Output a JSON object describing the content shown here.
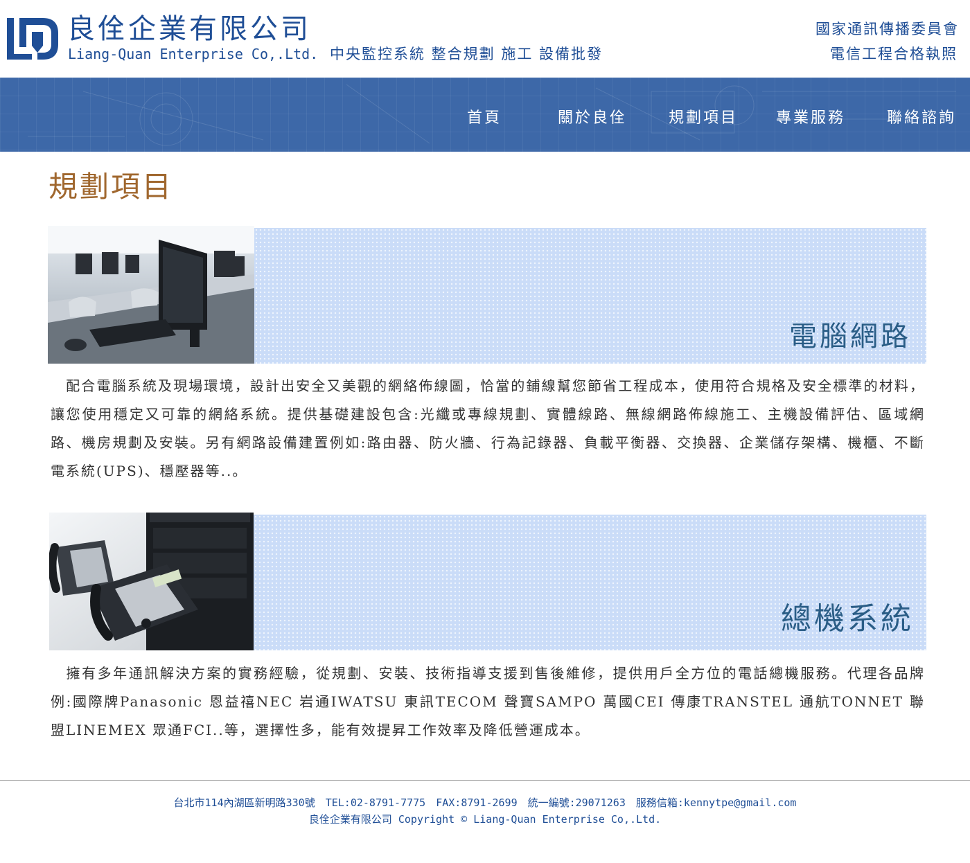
{
  "header": {
    "company_cn": "良佺企業有限公司",
    "company_en": "Liang-Quan Enterprise Co,.Ltd.",
    "tagline": "中央監控系統 整合規劃 施工 設備批發",
    "license_line1": "國家通訊傳播委員會",
    "license_line2": "電信工程合格執照"
  },
  "nav": {
    "items": [
      {
        "label": "首頁"
      },
      {
        "label": "關於良佺"
      },
      {
        "label": "規劃項目"
      },
      {
        "label": "專業服務"
      },
      {
        "label": "聯絡諮詢"
      }
    ]
  },
  "main": {
    "page_title": "規劃項目",
    "sections": [
      {
        "title": "電腦網路",
        "image_icon": "computer-lab-photo",
        "text": "　配合電腦系統及現場環境，設計出安全又美觀的網絡佈線圖，恰當的鋪線幫您節省工程成本，使用符合規格及安全標準的材料，讓您使用穩定又可靠的網絡系統。提供基礎建設包含:光纖或專線規劃、實體線路、無線網路佈線施工、主機設備評估、區域網路、機房規劃及安裝。另有網路設備建置例如:路由器、防火牆、行為記錄器、負載平衡器、交換器、企業儲存架構、機櫃、不斷電系統(UPS)、穩壓器等..。"
      },
      {
        "title": "總機系統",
        "image_icon": "pbx-phone-photo",
        "text": "　擁有多年通訊解決方案的實務經驗，從規劃、安裝、技術指導支援到售後維修，提供用戶全方位的電話總機服務。代理各品牌 例:國際牌Panasonic 恩益禧NEC 岩通IWATSU 東訊TECOM 聲寶SAMPO 萬國CEI 傳康TRANSTEL 通航TONNET 聯盟LINEMEX 眾通FCI..等，選擇性多，能有效提昇工作效率及降低營運成本。"
      }
    ]
  },
  "footer": {
    "line1": "台北市114內湖區新明路330號　TEL:02-8791-7775　FAX:8791-2699　統一編號:29071263　服務信箱:kennytpe@gmail.com",
    "line2": "良佺企業有限公司 Copyright © Liang-Quan Enterprise Co,.Ltd."
  },
  "colors": {
    "brand_blue": "#1f4e96",
    "nav_blue": "#3d68a8",
    "title_brown": "#a0672e",
    "section_title": "#2a5d86",
    "strip_bg": "#cadcf8"
  }
}
